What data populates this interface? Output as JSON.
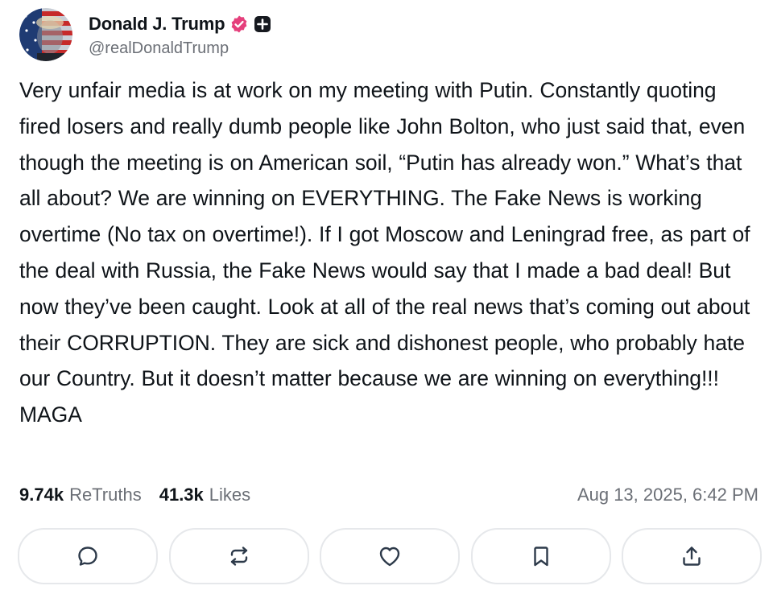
{
  "author": {
    "display_name": "Donald J. Trump",
    "handle": "@realDonaldTrump",
    "verified_badge_icon": "verified-badge-icon",
    "verified_color": "#e5407c",
    "extra_badge_icon": "plus-square-icon"
  },
  "post": {
    "text": "Very unfair media is at work on my meeting with Putin. Constantly quoting fired losers and really dumb people like John Bolton, who just said that, even though the meeting is on American soil, “Putin has already won.” What’s that all about? We are winning on EVERYTHING. The Fake News is working overtime (No tax on overtime!). If I got Moscow and Leningrad free, as part of the deal with Russia, the Fake News would say that I made a bad deal! But now they’ve been caught. Look at all of the real news that’s coming out about their CORRUPTION. They are sick and dishonest people, who probably hate our Country. But it doesn’t matter because we are winning on everything!!! MAGA"
  },
  "stats": {
    "retruths_count": "9.74k",
    "retruths_label": "ReTruths",
    "likes_count": "41.3k",
    "likes_label": "Likes",
    "timestamp": "Aug 13, 2025, 6:42 PM"
  },
  "actions": [
    {
      "icon": "reply-icon"
    },
    {
      "icon": "retruth-icon"
    },
    {
      "icon": "like-heart-icon"
    },
    {
      "icon": "bookmark-icon"
    },
    {
      "icon": "share-icon"
    }
  ],
  "colors": {
    "text_primary": "#0f1419",
    "text_secondary": "#6b6f76",
    "button_border": "#e6e8eb",
    "icon": "#2d3a4a"
  }
}
